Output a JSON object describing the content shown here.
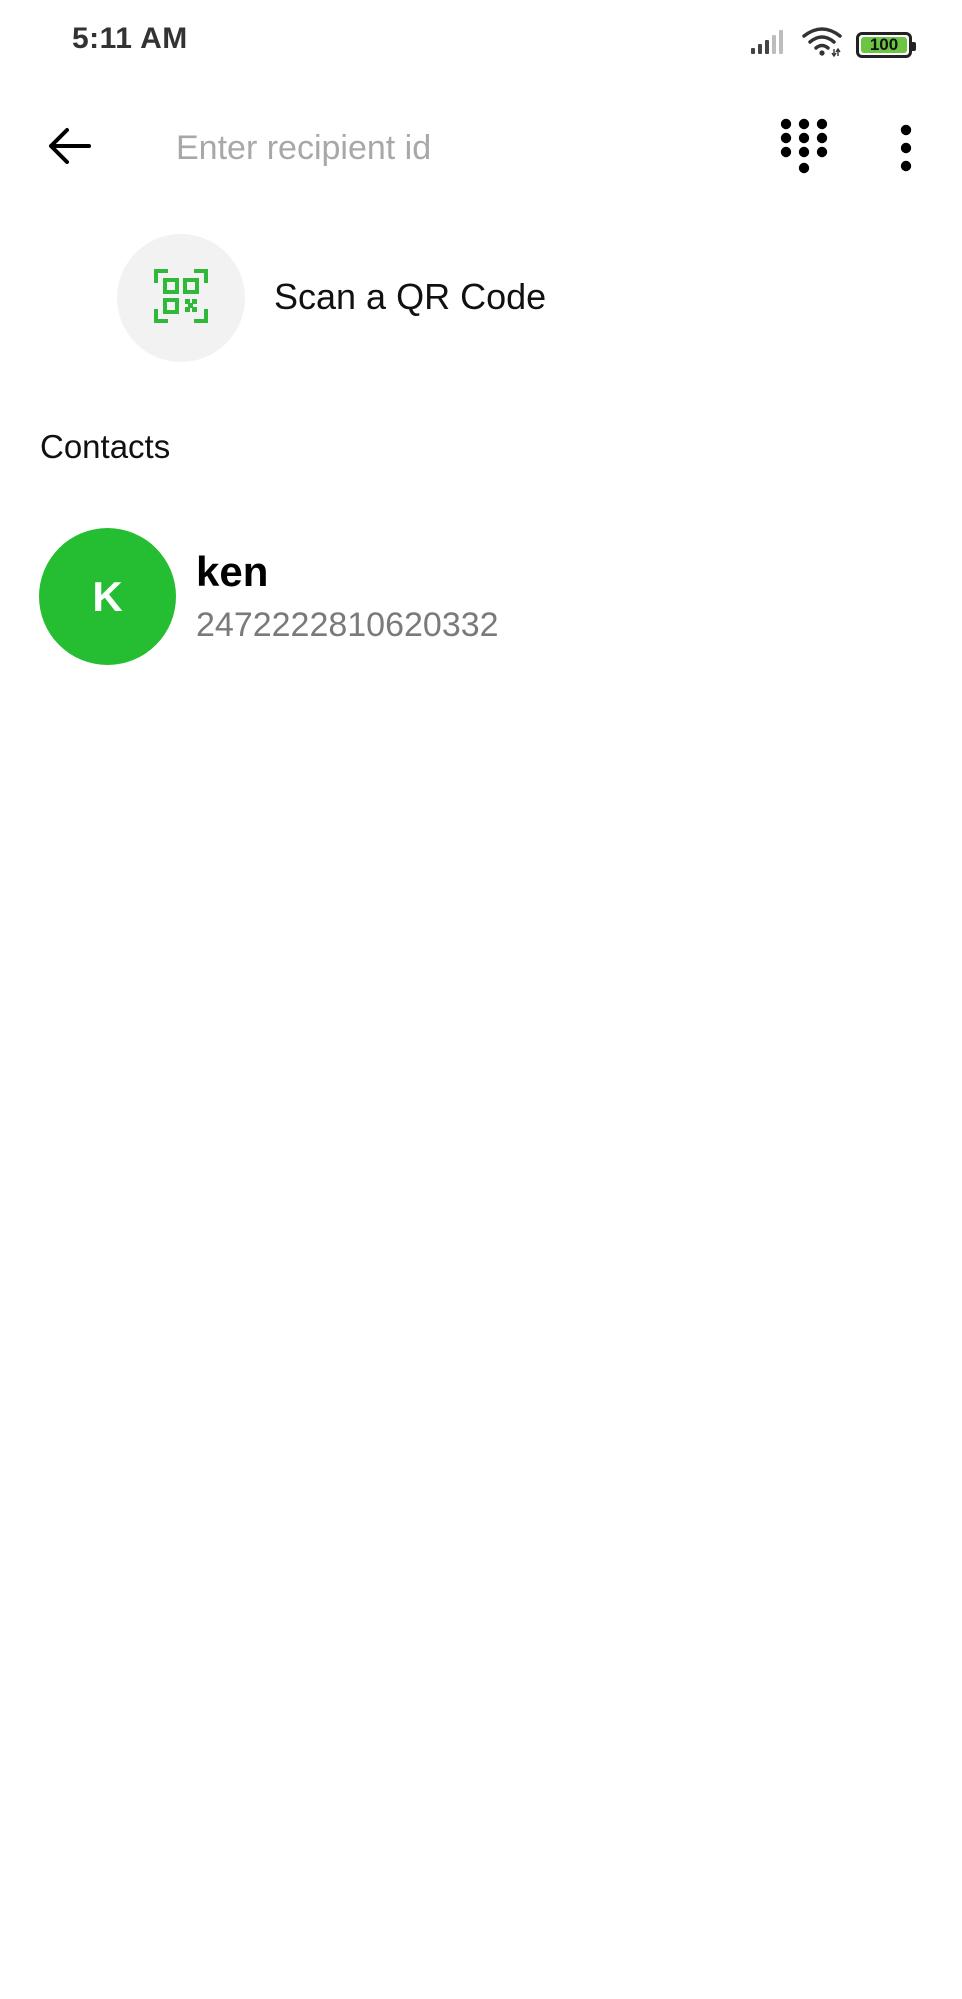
{
  "status_bar": {
    "time": "5:11 AM",
    "battery_level": "100",
    "icons": [
      "signal-icon",
      "wifi-icon",
      "battery-icon"
    ]
  },
  "top_bar": {
    "back_icon": "arrow-left-icon",
    "recipient_placeholder": "Enter recipient id",
    "recipient_value": "",
    "dialpad_icon": "dialpad-icon",
    "more_icon": "more-vertical-icon"
  },
  "qr": {
    "icon": "qr-code-icon",
    "label": "Scan a QR Code"
  },
  "contacts_section": {
    "header": "Contacts",
    "items": [
      {
        "initial": "K",
        "name": "ken",
        "id": "2472222810620332"
      }
    ]
  },
  "colors": {
    "accent_green": "#25be32",
    "qr_icon_green": "#2fb83a",
    "placeholder_gray": "#a8a8a8",
    "secondary_text": "#7a7a7a",
    "battery_fill": "#6cc644"
  }
}
